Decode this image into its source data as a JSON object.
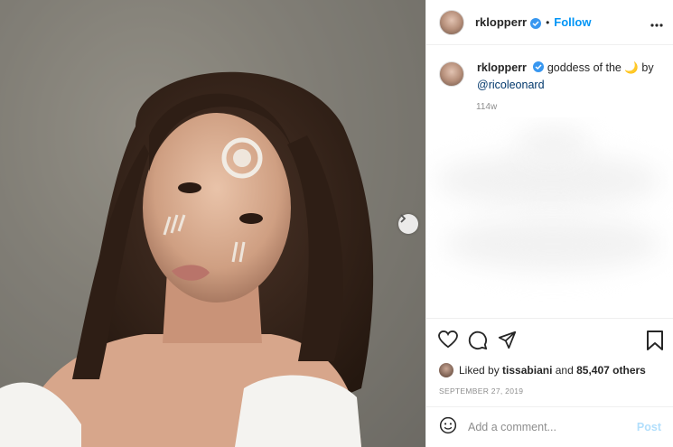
{
  "post": {
    "username": "rklopperr",
    "follow_label": "Follow",
    "separator": "•",
    "caption_text": "goddess of the 🌙 by",
    "mention": "@ricoleonard",
    "age": "114w",
    "liked_by_prefix": "Liked by",
    "liked_by_user": "tissabiani",
    "liked_by_and": "and",
    "likes_count": "85,407 others",
    "date": "SEPTEMBER 27, 2019"
  },
  "comment": {
    "placeholder": "Add a comment...",
    "post_label": "Post"
  },
  "icons": {
    "verified": "verified-badge-icon",
    "more": "more-options-icon",
    "like": "heart-icon",
    "comment": "comment-icon",
    "share": "paper-plane-icon",
    "save": "bookmark-icon",
    "emoji": "emoji-icon",
    "next": "chevron-right-icon"
  },
  "colors": {
    "accent": "#0095f6",
    "verified": "#3897f0",
    "mention": "#00376b",
    "post_disabled": "#b2dffc"
  }
}
